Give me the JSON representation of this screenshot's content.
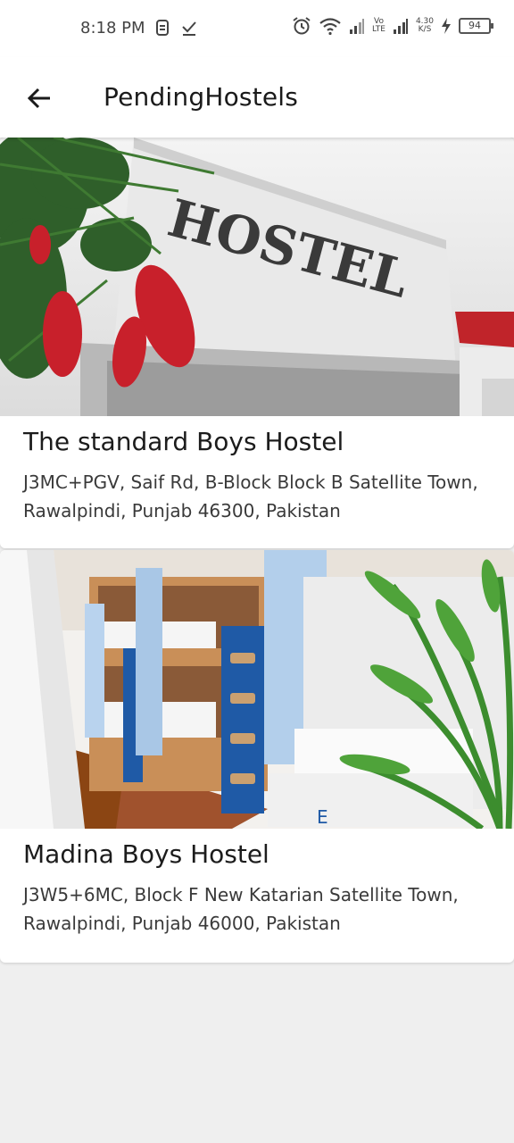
{
  "status_bar": {
    "time": "8:18 PM",
    "left_icons": [
      "sim-icon",
      "download-done-icon"
    ],
    "right_icons": [
      "alarm-icon",
      "wifi-icon",
      "signal-icon",
      "signal-icon"
    ],
    "volte_label": "Vo\nLTE",
    "network_speed": "4.30\nK/S",
    "battery_level": "94"
  },
  "app_bar": {
    "back_icon": "arrow-left-icon",
    "title": "PendingHostels"
  },
  "hostels": [
    {
      "name": "The standard Boys Hostel",
      "address": "J3MC+PGV, Saif Rd, B-Block Block B Satellite Town, Rawalpindi, Punjab 46300, Pakistan",
      "image_sign_text": "HOSTEL"
    },
    {
      "name": "Madina Boys Hostel",
      "address": "J3W5+6MC, Block F New Katarian Satellite Town, Rawalpindi, Punjab 46000, Pakistan"
    }
  ],
  "colors": {
    "background": "#efefef",
    "surface": "#ffffff",
    "text_primary": "#1c1c1c",
    "text_secondary": "#3a3a3a"
  }
}
